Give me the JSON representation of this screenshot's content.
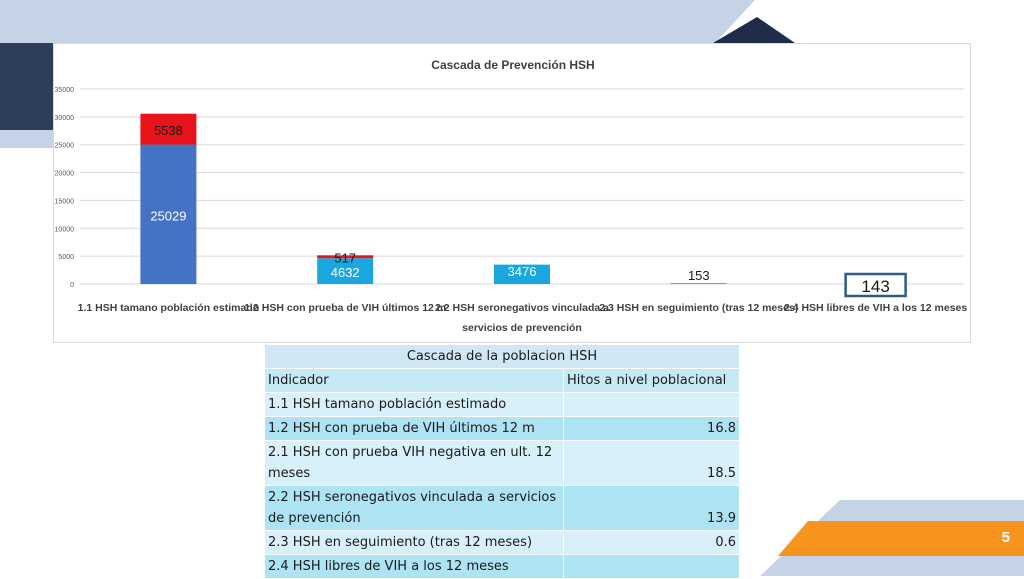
{
  "chart_data": {
    "type": "bar",
    "title": "Cascada de Prevención  HSH",
    "categories": [
      [
        "1.1 HSH tamano  población estimado"
      ],
      [
        "1.2 HSH con prueba de VIH últimos 12 m"
      ],
      [
        "2.2 HSH seronegativos vinculada a",
        "servicios de prevención"
      ],
      [
        "2.3 HSH en seguimiento (tras 12 meses)"
      ],
      [
        "2.4 HSH libres de VIH a los 12 meses"
      ]
    ],
    "series": [
      {
        "values": [
          25029,
          4632,
          3476,
          153,
          143
        ],
        "color": "#4472c4",
        "colors": [
          "#4472c4",
          "#1aa7e0",
          "#1aa7e0",
          "#1aa7e0",
          "#1aa7e0"
        ],
        "labels": [
          "25029",
          "4632",
          "3476",
          "153",
          "143"
        ]
      },
      {
        "values": [
          5538,
          517,
          0,
          0,
          0
        ],
        "color": "#e8141b",
        "labels": [
          "5538",
          "517",
          "",
          "",
          ""
        ]
      }
    ],
    "yticks": [
      "0",
      "5000",
      "10000",
      "15000",
      "20000",
      "25000",
      "30000",
      "35000"
    ],
    "ylim": [
      0,
      35000
    ],
    "grid": true
  },
  "table": {
    "title": "Cascada de la poblacion HSH",
    "headers": [
      "Indicador",
      "Hitos a nivel poblacional"
    ],
    "rows": [
      {
        "label": "1.1 HSH tamano  población estimado",
        "value": ""
      },
      {
        "label": "1.2 HSH con prueba de VIH últimos 12 m",
        "value": "16.8"
      },
      {
        "label": "2.1 HSH con prueba VIH negativa en ult. 12 meses",
        "value": "18.5"
      },
      {
        "label": "2.2 HSH seronegativos vinculada a servicios de prevención",
        "value": "13.9"
      },
      {
        "label": "2.3 HSH en seguimiento (tras 12 meses)",
        "value": "0.6"
      },
      {
        "label": "2.4 HSH libres de VIH a los 12 meses",
        "value": ""
      }
    ]
  },
  "page_number": "5",
  "colors": {
    "navy": "#2c3e5c",
    "light_blue": "#c5d3e6",
    "orange": "#f7941d",
    "table_light": "#d7f0f9",
    "table_dark": "#aee3f3"
  }
}
